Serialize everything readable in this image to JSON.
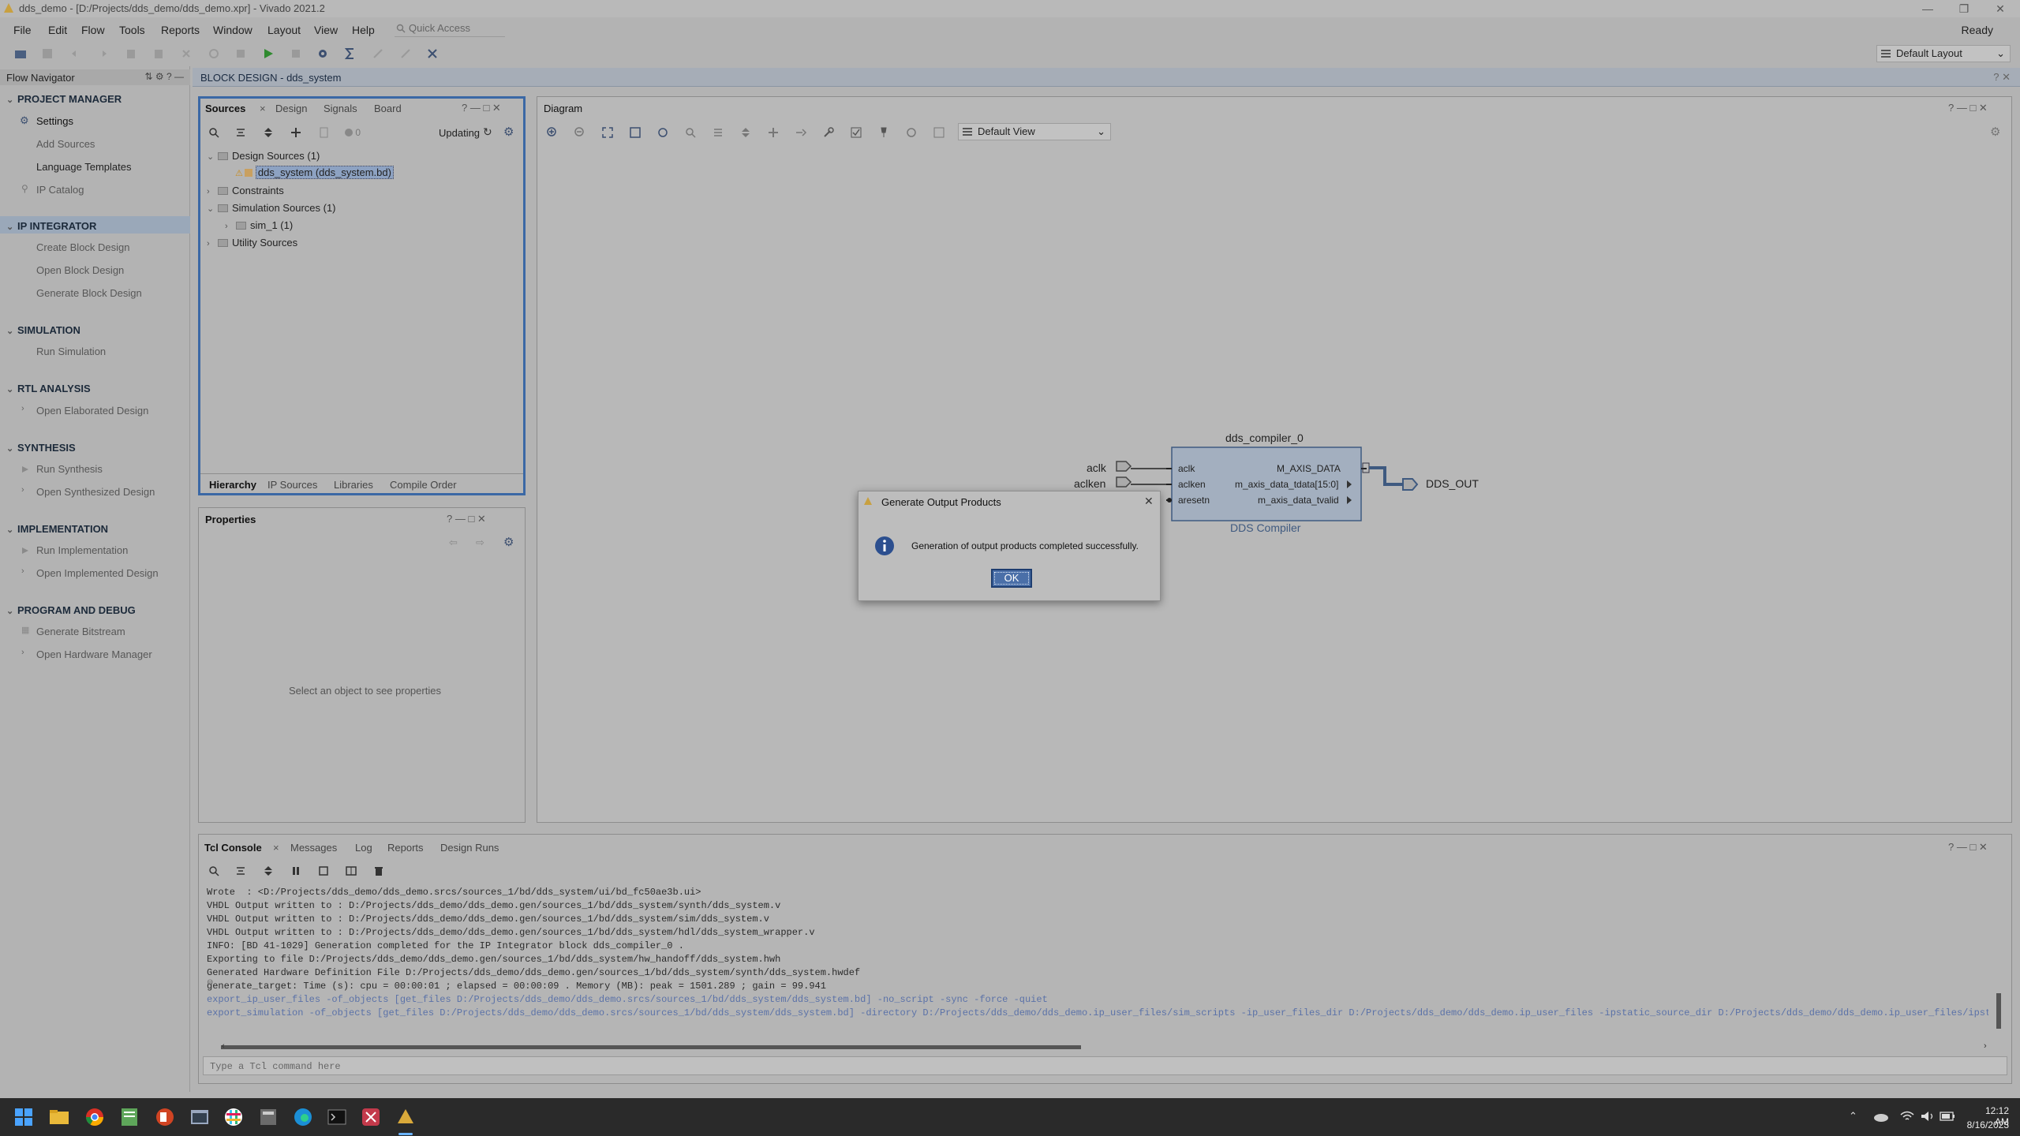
{
  "window": {
    "title": "dds_demo - [D:/Projects/dds_demo/dds_demo.xpr] - Vivado 2021.2",
    "status": "Ready"
  },
  "menu": [
    "File",
    "Edit",
    "Flow",
    "Tools",
    "Reports",
    "Window",
    "Layout",
    "View",
    "Help"
  ],
  "quick_access": {
    "placeholder": "Quick Access"
  },
  "layout_select": {
    "value": "Default Layout"
  },
  "flow_navigator": {
    "title": "Flow Navigator",
    "sections": [
      {
        "label": "PROJECT MANAGER",
        "items": [
          "Settings",
          "Add Sources",
          "Language Templates",
          "IP Catalog"
        ]
      },
      {
        "label": "IP INTEGRATOR",
        "items": [
          "Create Block Design",
          "Open Block Design",
          "Generate Block Design"
        ]
      },
      {
        "label": "SIMULATION",
        "items": [
          "Run Simulation"
        ]
      },
      {
        "label": "RTL ANALYSIS",
        "items": [
          "Open Elaborated Design"
        ]
      },
      {
        "label": "SYNTHESIS",
        "items": [
          "Run Synthesis",
          "Open Synthesized Design"
        ]
      },
      {
        "label": "IMPLEMENTATION",
        "items": [
          "Run Implementation",
          "Open Implemented Design"
        ]
      },
      {
        "label": "PROGRAM AND DEBUG",
        "items": [
          "Generate Bitstream",
          "Open Hardware Manager"
        ]
      }
    ]
  },
  "block_design_header": "BLOCK DESIGN - dds_system",
  "sources": {
    "tabs": [
      "Sources",
      "Design",
      "Signals",
      "Board"
    ],
    "badge_count": "0",
    "updating": "Updating",
    "tree": [
      "Design Sources (1)",
      "dds_system (dds_system.bd)",
      "Constraints",
      "Simulation Sources (1)",
      "sim_1 (1)",
      "Utility Sources"
    ],
    "bottom_tabs": [
      "Hierarchy",
      "IP Sources",
      "Libraries",
      "Compile Order"
    ]
  },
  "properties": {
    "title": "Properties",
    "empty": "Select an object to see properties"
  },
  "diagram": {
    "title": "Diagram",
    "view_select": "Default View",
    "block": {
      "instance": "dds_compiler_0",
      "type": "DDS Compiler",
      "in_ports": [
        "aclk",
        "aclken",
        "aresetn"
      ],
      "out_ports": [
        "M_AXIS_DATA",
        "m_axis_data_tdata[15:0]",
        "m_axis_data_tvalid"
      ],
      "ext_in": [
        "aclk",
        "aclken"
      ],
      "ext_out": "DDS_OUT"
    }
  },
  "console": {
    "tabs": [
      "Tcl Console",
      "Messages",
      "Log",
      "Reports",
      "Design Runs"
    ],
    "lines": [
      "Wrote  : <D:/Projects/dds_demo/dds_demo.srcs/sources_1/bd/dds_system/ui/bd_fc50ae3b.ui>",
      "VHDL Output written to : D:/Projects/dds_demo/dds_demo.gen/sources_1/bd/dds_system/synth/dds_system.v",
      "VHDL Output written to : D:/Projects/dds_demo/dds_demo.gen/sources_1/bd/dds_system/sim/dds_system.v",
      "VHDL Output written to : D:/Projects/dds_demo/dds_demo.gen/sources_1/bd/dds_system/hdl/dds_system_wrapper.v",
      "INFO: [BD 41-1029] Generation completed for the IP Integrator block dds_compiler_0 .",
      "Exporting to file D:/Projects/dds_demo/dds_demo.gen/sources_1/bd/dds_system/hw_handoff/dds_system.hwh",
      "Generated Hardware Definition File D:/Projects/dds_demo/dds_demo.gen/sources_1/bd/dds_system/synth/dds_system.hwdef",
      "generate_target: Time (s): cpu = 00:00:01 ; elapsed = 00:00:09 . Memory (MB): peak = 1501.289 ; gain = 99.941",
      "export_ip_user_files -of_objects [get_files D:/Projects/dds_demo/dds_demo.srcs/sources_1/bd/dds_system/dds_system.bd] -no_script -sync -force -quiet",
      "export_simulation -of_objects [get_files D:/Projects/dds_demo/dds_demo.srcs/sources_1/bd/dds_system/dds_system.bd] -directory D:/Projects/dds_demo/dds_demo.ip_user_files/sim_scripts -ip_user_files_dir D:/Projects/dds_demo/dds_demo.ip_user_files -ipstatic_source_dir D:/Projects/dds_demo/dds_demo.ip_user_files/ipstatic -l"
    ],
    "input_placeholder": "Type a Tcl command here"
  },
  "dialog": {
    "title": "Generate Output Products",
    "message": "Generation of output products completed successfully.",
    "ok": "OK"
  },
  "taskbar": {
    "time": "12:12 AM",
    "date": "8/16/2023"
  }
}
